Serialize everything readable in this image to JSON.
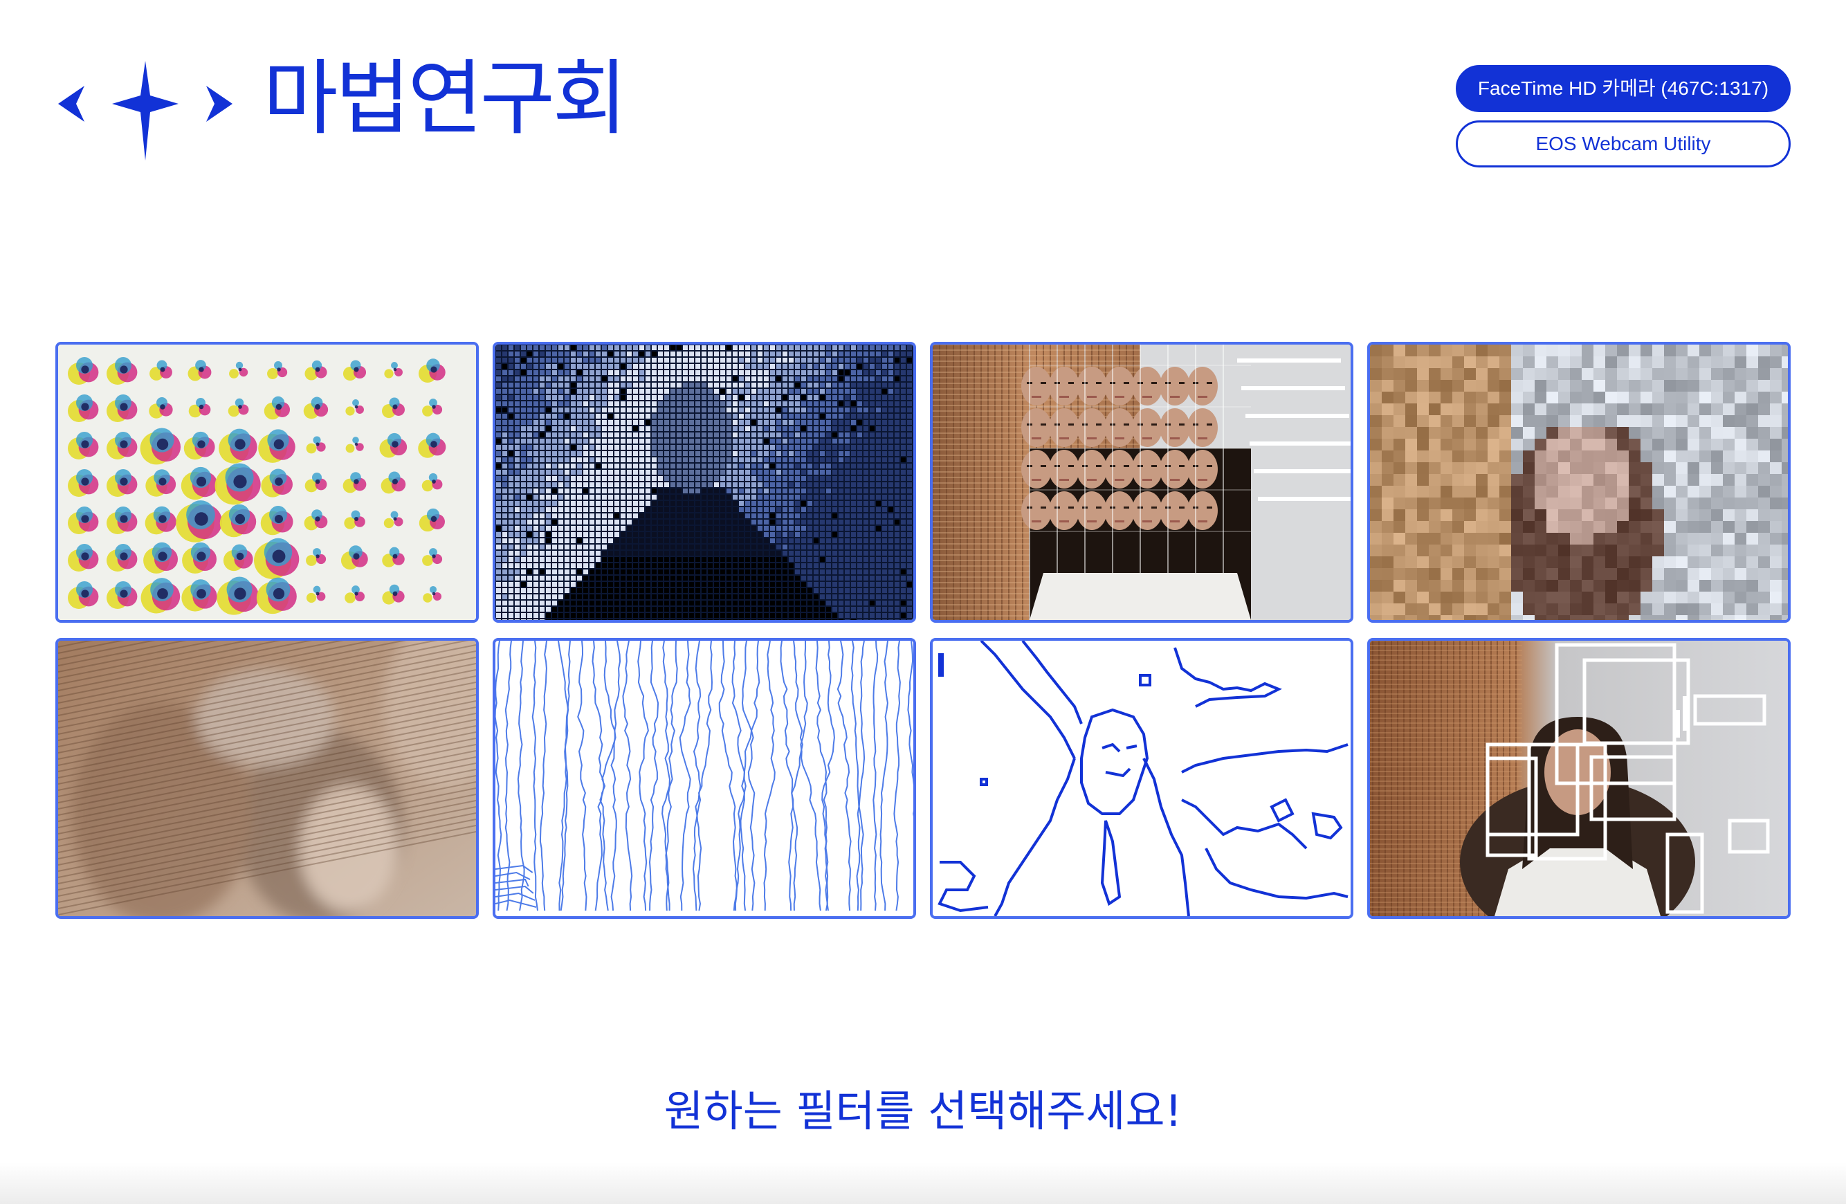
{
  "header": {
    "title": "마법연구회",
    "logo_icons": [
      "chevron-left-icon",
      "sparkle-star-icon",
      "chevron-right-icon"
    ]
  },
  "cameras": [
    {
      "label": "FaceTime HD 카메라 (467C:1317)",
      "selected": true
    },
    {
      "label": "EOS Webcam Utility",
      "selected": false
    }
  ],
  "filters": [
    {
      "id": "halftone-cmyk"
    },
    {
      "id": "dot-grid-blue"
    },
    {
      "id": "slit-mirror"
    },
    {
      "id": "pixelate"
    },
    {
      "id": "ghost-blend"
    },
    {
      "id": "line-wave"
    },
    {
      "id": "edge-outline"
    },
    {
      "id": "face-boxes"
    }
  ],
  "prompt": "원하는 필터를 선택해주세요!",
  "colors": {
    "accent": "#1232d6",
    "tile_border": "#4a6ef0",
    "background": "#ffffff"
  }
}
